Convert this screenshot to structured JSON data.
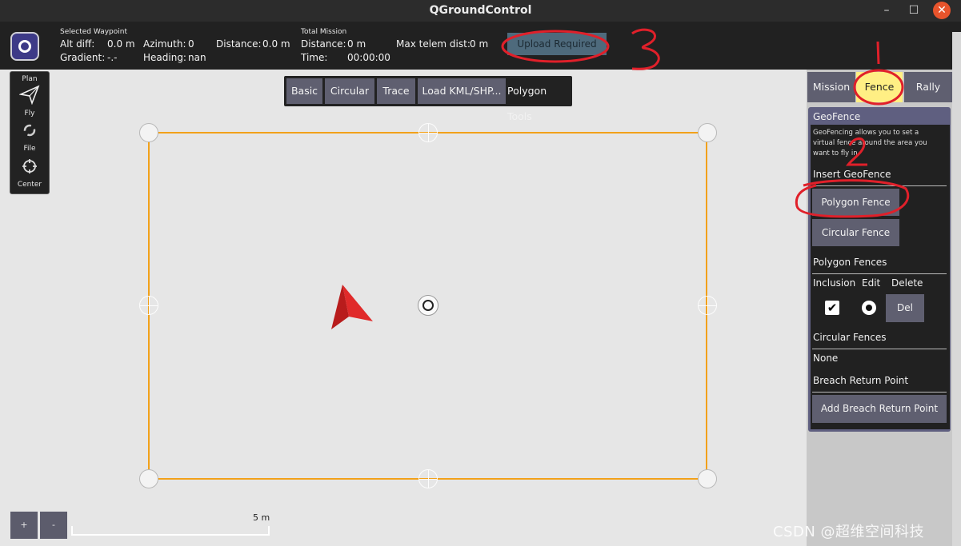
{
  "window": {
    "title": "QGroundControl",
    "minimize": "–",
    "maximize": "☐",
    "close": "✕"
  },
  "infobar": {
    "selected_waypoint_title": "Selected Waypoint",
    "alt_diff_label": "Alt diff:",
    "alt_diff_value": "0.0 m",
    "gradient_label": "Gradient:",
    "gradient_value": "-.-",
    "azimuth_label": "Azimuth:",
    "azimuth_value": "0",
    "heading_label": "Heading:",
    "heading_value": "nan",
    "distance_label": "Distance:",
    "distance_value": "0.0 m",
    "total_mission_title": "Total Mission",
    "total_distance_label": "Distance:",
    "total_distance_value": "0 m",
    "time_label": "Time:",
    "time_value": "00:00:00",
    "max_telem_label": "Max telem dist:",
    "max_telem_value": "0 m",
    "upload_button": "Upload Required"
  },
  "plan_toolbar": {
    "title": "Plan",
    "fly": "Fly",
    "file": "File",
    "center": "Center"
  },
  "polygon_tools": {
    "basic": "Basic",
    "circular": "Circular",
    "trace": "Trace",
    "load": "Load KML/SHP...",
    "label": "Polygon Tools"
  },
  "map": {
    "scale_label": "5 m",
    "zoom_in": "+",
    "zoom_out": "-"
  },
  "tabs": {
    "mission": "Mission",
    "fence": "Fence",
    "rally": "Rally",
    "active": "Fence"
  },
  "geofence": {
    "title": "GeoFence",
    "description": "GeoFencing allows you to set a virtual fence around the area you want to fly in.",
    "insert_header": "Insert GeoFence",
    "polygon_fence_button": "Polygon Fence",
    "circular_fence_button": "Circular Fence",
    "polygon_fences_header": "Polygon Fences",
    "col_inclusion": "Inclusion",
    "col_edit": "Edit",
    "col_delete": "Delete",
    "del_button": "Del",
    "circular_fences_header": "Circular Fences",
    "circular_none": "None",
    "breach_header": "Breach Return Point",
    "add_breach_button": "Add Breach Return Point"
  },
  "annotations": {
    "one": "1",
    "two": "2",
    "three": "3"
  },
  "watermark": "CSDN @超维空间科技",
  "colors": {
    "fence": "#f2a11a",
    "annotation": "#e0202a",
    "highlight": "#ffef84",
    "button": "#5f5f70"
  }
}
